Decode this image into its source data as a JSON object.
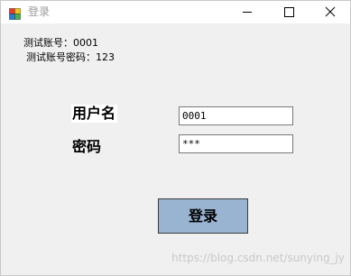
{
  "window": {
    "title": "登录",
    "icon": "winforms-app-icon",
    "controls": {
      "minimize_icon": "minimize-icon",
      "maximize_icon": "maximize-icon",
      "close_icon": "close-icon"
    }
  },
  "hints": {
    "account": "测试账号：0001",
    "password": "测试账号密码：123"
  },
  "form": {
    "username_label": "用户名",
    "password_label": "密码",
    "username_value": "0001",
    "password_value": "***",
    "login_label": "登录"
  },
  "watermark": "https://blog.csdn.net/sunying_jy",
  "colors": {
    "window_bg": "#f0f0f0",
    "titlebar_bg": "#ffffff",
    "button_bg": "#99b4d1",
    "title_text": "#9a9a9a"
  }
}
